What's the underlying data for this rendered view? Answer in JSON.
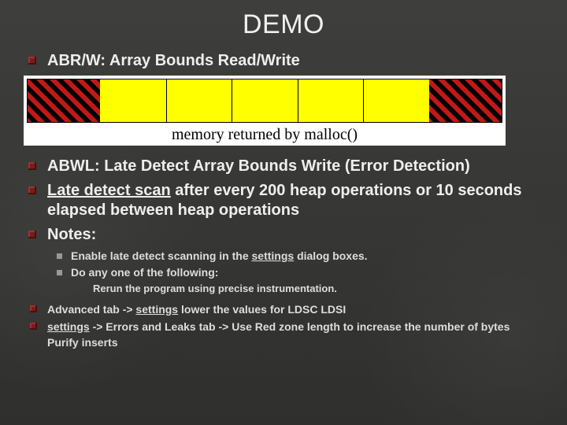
{
  "title": "DEMO",
  "bullets": {
    "b1": "ABR/W: Array Bounds Read/Write",
    "b2": "ABWL: Late Detect Array Bounds Write (Error Detection)",
    "b3_pre": "Late detect scan",
    "b3_post": " after every 200 heap operations or 10 seconds elapsed between heap operations",
    "b4": "Notes:"
  },
  "diagram": {
    "caption": "memory returned by malloc()"
  },
  "sub": {
    "s1_pre": "Enable late detect scanning in the ",
    "s1_link": "settings",
    "s1_post": " dialog boxes.",
    "s2": "Do any one of the following:"
  },
  "subsub": {
    "ss1": "Rerun the program using precise instrumentation."
  },
  "bottom": {
    "t1_a": "Advanced tab -> ",
    "t1_link": "settings",
    "t1_b": " lower the values for LDSC LDSI",
    "t2_link": "settings",
    "t2_b": " -> Errors and Leaks tab -> Use Red zone length to increase the number of bytes Purify inserts"
  }
}
